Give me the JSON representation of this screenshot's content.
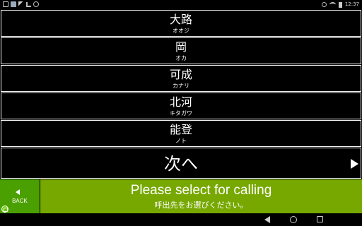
{
  "status_bar": {
    "time": "12:37",
    "icons": [
      "notification-icon",
      "image-icon",
      "signal-icon",
      "check-icon",
      "sync-icon",
      "alarm-icon",
      "wifi-icon",
      "battery-icon"
    ]
  },
  "list": {
    "items": [
      {
        "kanji": "大路",
        "kana": "オオジ"
      },
      {
        "kanji": "岡",
        "kana": "オカ"
      },
      {
        "kanji": "可成",
        "kana": "カナリ"
      },
      {
        "kanji": "北河",
        "kana": "キタガワ"
      },
      {
        "kanji": "能登",
        "kana": "ノト"
      }
    ],
    "next_label": "次へ"
  },
  "footer": {
    "back_label": "BACK",
    "prompt_en": "Please select for calling",
    "prompt_ja": "呼出先をお選びください。",
    "colors": {
      "back": "#4aa000",
      "banner": "#77a800"
    }
  }
}
